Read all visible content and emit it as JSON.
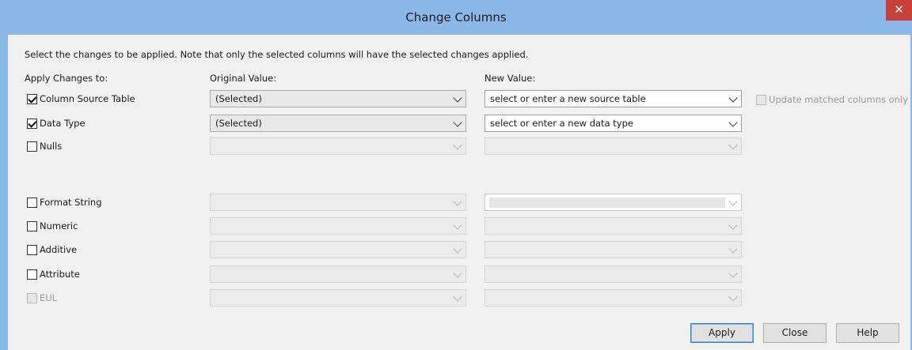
{
  "window": {
    "title": "Change Columns",
    "close_glyph": "✕"
  },
  "instructions": "Select the changes to be applied. Note that only the selected columns will have the selected changes applied.",
  "headers": {
    "apply": "Apply Changes to:",
    "original": "Original Value:",
    "new": "New Value:"
  },
  "rows": [
    {
      "label": "Column Source Table",
      "checked": true,
      "enabled": true,
      "original": "(Selected)",
      "new_placeholder": "select or enter a new source table"
    },
    {
      "label": "Data Type",
      "checked": true,
      "enabled": true,
      "original": "(Selected)",
      "new_placeholder": "select or enter a new data type"
    },
    {
      "label": "Nulls",
      "checked": false,
      "enabled": true,
      "original": "",
      "new_placeholder": ""
    },
    {
      "label": "Format String",
      "checked": false,
      "enabled": true,
      "original": "",
      "new_placeholder": ""
    },
    {
      "label": "Numeric",
      "checked": false,
      "enabled": true,
      "original": "",
      "new_placeholder": ""
    },
    {
      "label": "Additive",
      "checked": false,
      "enabled": true,
      "original": "",
      "new_placeholder": ""
    },
    {
      "label": "Attribute",
      "checked": false,
      "enabled": true,
      "original": "",
      "new_placeholder": ""
    },
    {
      "label": "EUL",
      "checked": false,
      "enabled": false,
      "original": "",
      "new_placeholder": ""
    }
  ],
  "update_matched_only": {
    "label": "Update matched columns only",
    "checked": false,
    "enabled": false
  },
  "buttons": {
    "apply": "Apply",
    "close": "Close",
    "help": "Help"
  },
  "colors": {
    "title_bar": "#8bb8e8",
    "close_button": "#c7413a",
    "dialog_bg": "#f0f0f0"
  }
}
